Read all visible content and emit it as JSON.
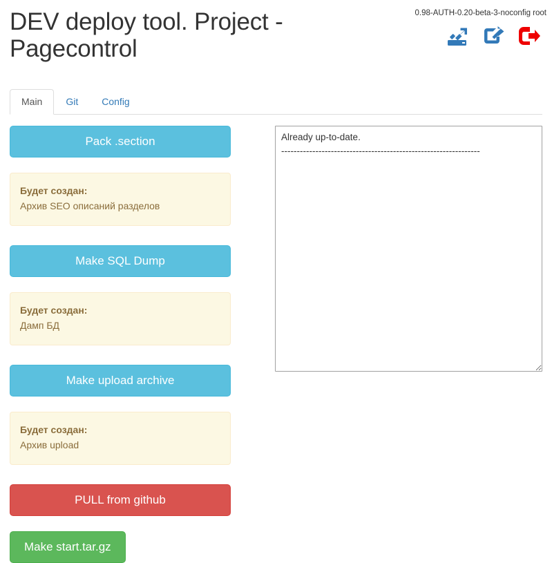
{
  "header": {
    "title": "DEV deploy tool. Project - Pagecontrol",
    "version": "0.98-AUTH-0.20-beta-3-noconfig root",
    "icons": [
      {
        "name": "server-upload-icon",
        "label": "Upload to server",
        "color": "#3279b8"
      },
      {
        "name": "share-external-icon",
        "label": "Open external",
        "color": "#3279b8"
      },
      {
        "name": "logout-icon",
        "label": "Logout",
        "color": "#ee0000"
      }
    ]
  },
  "tabs": [
    {
      "label": "Main",
      "active": true
    },
    {
      "label": "Git",
      "active": false
    },
    {
      "label": "Config",
      "active": false
    }
  ],
  "actions": {
    "pack_section": {
      "button_label": "Pack .section",
      "note_title": "Будет создан:",
      "note_body": "Архив SEO описаний разделов"
    },
    "sql_dump": {
      "button_label": "Make SQL Dump",
      "note_title": "Будет создан:",
      "note_body": "Дамп БД"
    },
    "upload_archive": {
      "button_label": "Make upload archive",
      "note_title": "Будет создан:",
      "note_body": "Архив upload"
    },
    "pull_github": {
      "button_label": "PULL from github"
    },
    "make_start_targz": {
      "button_label": "Make start.tar.gz"
    }
  },
  "output": {
    "text": "Already up-to-date.\n----------------------------------------------------------------",
    "placeholder": ""
  },
  "colors": {
    "info": "#5bc0de",
    "danger": "#d9534f",
    "success": "#5cb85c",
    "note_bg": "#fcf8e3",
    "note_border": "#faebcc",
    "note_text": "#8a6d3b",
    "link": "#337ab7"
  }
}
